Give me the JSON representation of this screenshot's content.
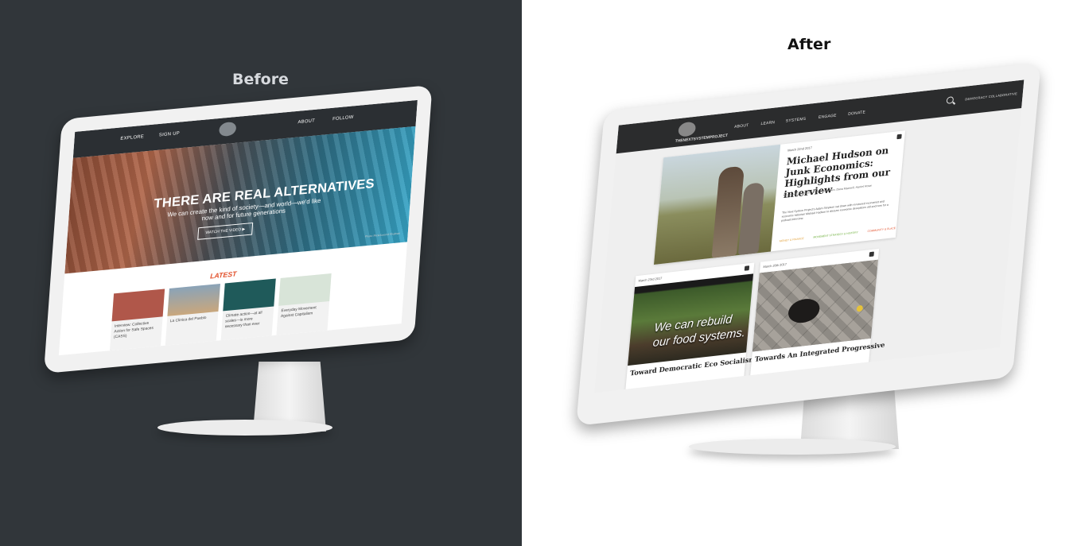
{
  "captions": {
    "before": "Before",
    "after": "After"
  },
  "colors": {
    "left_bg": "#31363a",
    "right_bg": "#ffffff",
    "accent_latest": "#e2502b",
    "nav_dark": "#2b2c2d"
  },
  "before_site": {
    "nav": {
      "explore": "EXPLORE",
      "sign_up": "SIGN UP",
      "about": "ABOUT",
      "follow": "FOLLOW"
    },
    "hero": {
      "title": "THERE ARE REAL ALTERNATIVES",
      "subtitle": "We can create the kind of society—and world—we'd like now and for future generations",
      "button": "WATCH THE VIDEO ▶",
      "credit": "Photo: Flickr/Leonid Shulman"
    },
    "latest_heading": "LATEST",
    "cards": [
      {
        "label": "Interview: Collective Action for Safe Spaces (CASS)"
      },
      {
        "label": "La Clinica del Pueblo"
      },
      {
        "label": "Climate action—at all scales—is more necessary than ever"
      },
      {
        "label": "Everyday Movement Against Capitalism"
      }
    ]
  },
  "after_site": {
    "nav": {
      "logo_text": "THENEXTSYSTEMPROJECT",
      "items": [
        "ABOUT",
        "LEARN",
        "SYSTEMS",
        "ENGAGE",
        "DONATE"
      ],
      "partner": "DEMOCRACY COLLABORATIVE"
    },
    "feature": {
      "date": "March 22nd 2017",
      "headline": "Michael Hudson on Junk Economics: Highlights from our interview",
      "authors": "by Conner Underwood, Rafa Christensen, Dana Maxwell, Harriet Rowe",
      "description": "The Next System Project's Adam Simpson sat down with renowned economist and economic historian Michael Hudson to discuss economic deceptions old and new for a podcast interview.",
      "tags": [
        "MONEY & FINANCE",
        "MOVEMENT STRATEGY & HISTORY",
        "COMMUNITY & PLACE"
      ]
    },
    "cards": [
      {
        "date": "March 23rd 2017",
        "image_text": "We can rebuild our food systems.",
        "title": "Toward Democratic Eco Socialism"
      },
      {
        "date": "March 20th 2017",
        "title": "Towards An Integrated Progressive"
      }
    ]
  }
}
